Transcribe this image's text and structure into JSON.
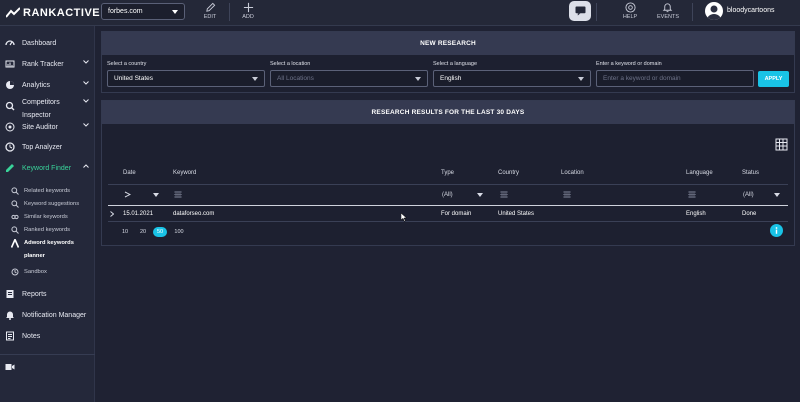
{
  "app": {
    "logo_text": "RANKACTIVE",
    "project": "forbes.com",
    "actions": {
      "edit": "EDIT",
      "add": "ADD",
      "help": "HELP",
      "events": "EVENTS"
    },
    "user": "bloodycartoons",
    "accent_color": "#19c3e6",
    "active_color": "#39d39a"
  },
  "sidebar": {
    "items": [
      {
        "label": "Dashboard",
        "icon": "dashboard-icon"
      },
      {
        "label": "Rank Tracker",
        "icon": "rank-tracker-icon"
      },
      {
        "label": "Analytics",
        "icon": "analytics-icon"
      },
      {
        "label": "Competitors",
        "label2": "Inspector",
        "icon": "competitors-icon"
      },
      {
        "label": "Site Auditor",
        "icon": "site-auditor-icon"
      },
      {
        "label": "Top Analyzer",
        "icon": "top-analyzer-icon"
      },
      {
        "label": "Keyword Finder",
        "icon": "keyword-finder-icon"
      },
      {
        "label": "Reports",
        "icon": "reports-icon"
      },
      {
        "label": "Notification Manager",
        "icon": "bell-icon"
      },
      {
        "label": "Notes",
        "icon": "notes-icon"
      }
    ],
    "sub_items": [
      {
        "label": "Related keywords"
      },
      {
        "label": "Keyword suggestions"
      },
      {
        "label": "Similar keywords"
      },
      {
        "label": "Ranked keywords"
      },
      {
        "label": "Adword keywords",
        "label2": "planner"
      },
      {
        "label": "Sandbox"
      }
    ]
  },
  "new_research": {
    "title": "NEW RESEARCH",
    "country_label": "Select a country",
    "country_value": "United States",
    "location_label": "Select a location",
    "location_placeholder": "All Locations",
    "language_label": "Select a language",
    "language_value": "English",
    "keyword_label": "Enter a keyword or domain",
    "keyword_placeholder": "Enter a keyword or domain",
    "apply": "APPLY"
  },
  "results": {
    "title": "RESEARCH RESULTS FOR THE LAST 30 DAYS",
    "columns": [
      "Date",
      "Keyword",
      "Type",
      "Country",
      "Location",
      "Language",
      "Status"
    ],
    "filters": {
      "type": "(All)",
      "status": "(All)"
    },
    "rows": [
      {
        "date": "15.01.2021",
        "keyword": "dataforseo.com",
        "type": "For domain",
        "country": "United States",
        "location": "",
        "language": "English",
        "status": "Done"
      }
    ],
    "page_sizes": [
      "10",
      "20",
      "50",
      "100"
    ],
    "active_page_size": "50"
  }
}
